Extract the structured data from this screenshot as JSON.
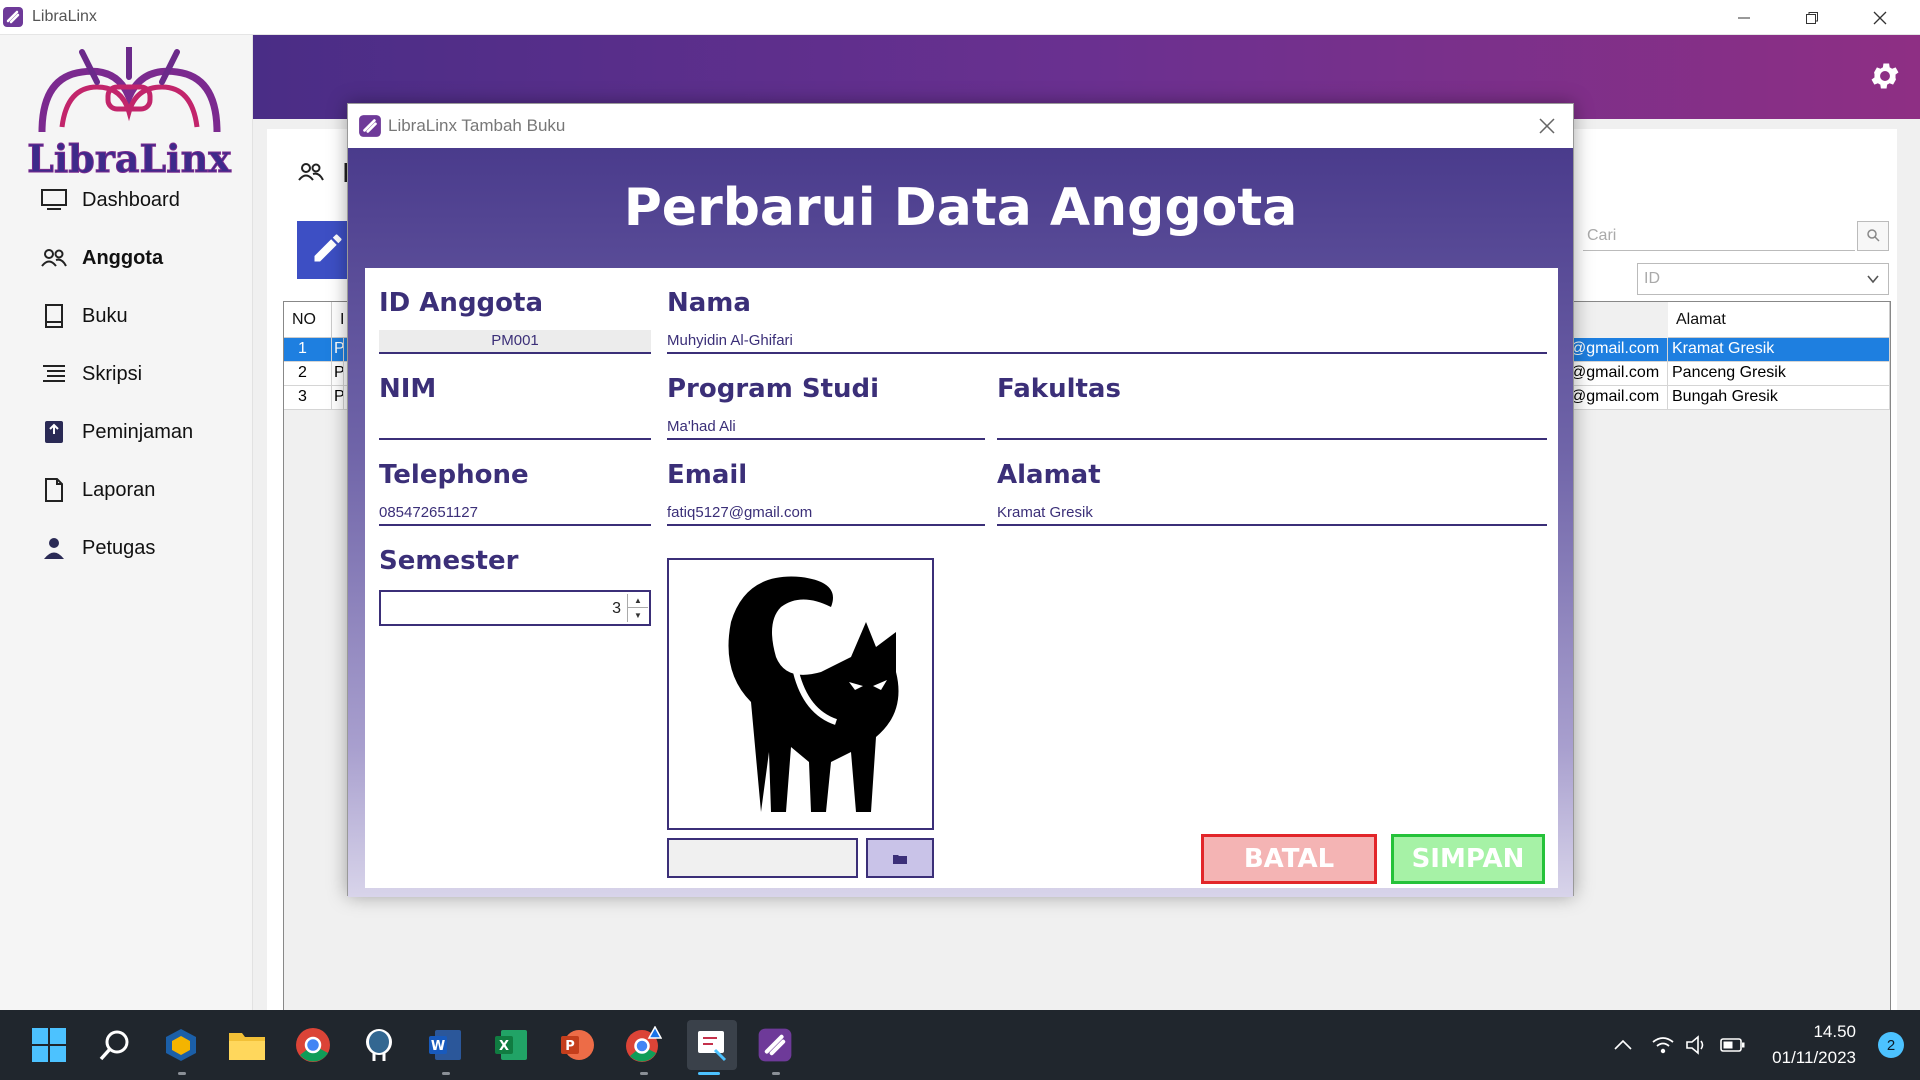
{
  "window": {
    "title": "LibraLinx"
  },
  "sidebar": {
    "logo_text": "LibraLinx",
    "items": [
      {
        "label": "Dashboard",
        "icon": "monitor-icon"
      },
      {
        "label": "Anggota",
        "icon": "users-icon",
        "active": true
      },
      {
        "label": "Buku",
        "icon": "book-icon"
      },
      {
        "label": "Skripsi",
        "icon": "list-icon"
      },
      {
        "label": "Peminjaman",
        "icon": "book-upload-icon"
      },
      {
        "label": "Laporan",
        "icon": "report-icon"
      },
      {
        "label": "Petugas",
        "icon": "user-icon"
      }
    ]
  },
  "page": {
    "heading": "Da",
    "search_placeholder": "Cari",
    "filter_value": "ID"
  },
  "table": {
    "headers": {
      "no": "NO",
      "col2": "I",
      "alamat": "Alamat"
    },
    "rows": [
      {
        "no": "1",
        "col2": "P",
        "email": "@gmail.com",
        "alamat": "Kramat Gresik",
        "selected": true
      },
      {
        "no": "2",
        "col2": "P",
        "email": "@gmail.com",
        "alamat": "Panceng Gresik"
      },
      {
        "no": "3",
        "col2": "P",
        "email": "@gmail.com",
        "alamat": "Bungah Gresik"
      }
    ]
  },
  "modal": {
    "title": "LibraLinx Tambah Buku",
    "heading": "Perbarui Data Anggota",
    "fields": {
      "id_anggota": {
        "label": "ID Anggota",
        "value": "PM001"
      },
      "nama": {
        "label": "Nama",
        "value": "Muhyidin Al-Ghifari"
      },
      "nim": {
        "label": "NIM",
        "value": ""
      },
      "program_studi": {
        "label": "Program Studi",
        "value": "Ma'had Ali"
      },
      "fakultas": {
        "label": "Fakultas",
        "value": ""
      },
      "telephone": {
        "label": "Telephone",
        "value": "085472651127"
      },
      "email": {
        "label": "Email",
        "value": "fatiq5127@gmail.com"
      },
      "alamat": {
        "label": "Alamat",
        "value": "Kramat Gresik"
      },
      "semester": {
        "label": "Semester",
        "value": "3"
      }
    },
    "photo": {
      "icon": "black-cat-photo",
      "path_value": ""
    },
    "buttons": {
      "batal": "BATAL",
      "simpan": "SIMPAN"
    }
  },
  "taskbar": {
    "time": "14.50",
    "date": "01/11/2023",
    "notifications": "2",
    "apps": [
      "start-icon",
      "search-icon",
      "virtualbox-icon",
      "file-explorer-icon",
      "chrome-icon",
      "postgresql-icon",
      "word-icon",
      "excel-icon",
      "powerpoint-icon",
      "chrome-canary-icon",
      "snipping-tool-icon",
      "libralinx-icon"
    ]
  },
  "colors": {
    "header_gradient_start": "#4a2d86",
    "header_gradient_end": "#8e2f84",
    "form_accent": "#3b2f78",
    "selected_row": "#1e7fe0",
    "batal_border": "#e2262a",
    "simpan_border": "#25c23a"
  }
}
